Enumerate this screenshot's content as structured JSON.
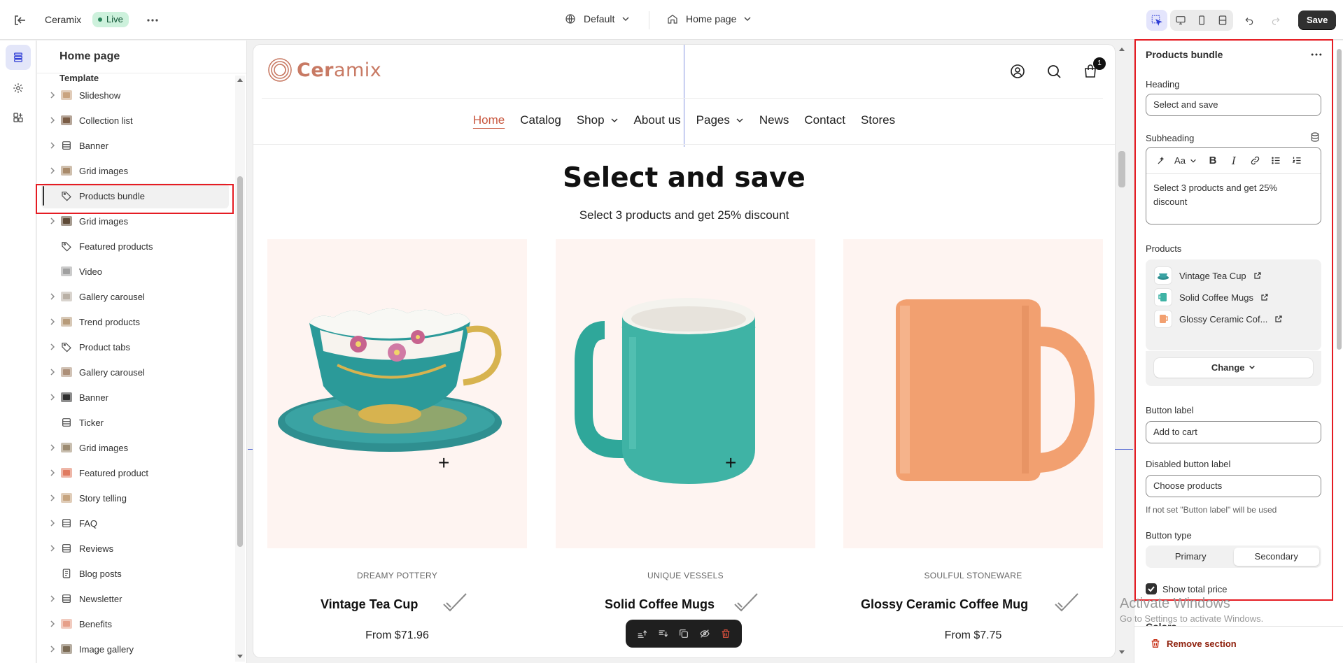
{
  "topbar": {
    "store_name": "Ceramix",
    "status_badge": "Live",
    "theme_selector": "Default",
    "page_selector": "Home page",
    "save_label": "Save"
  },
  "sidebar": {
    "title": "Home page",
    "group_label": "Template",
    "items": [
      {
        "label": "Slideshow",
        "icon": "image-thumbnail",
        "expandable": true
      },
      {
        "label": "Collection list",
        "icon": "image-thumbnail",
        "expandable": true
      },
      {
        "label": "Banner",
        "icon": "layout-icon",
        "expandable": true
      },
      {
        "label": "Grid images",
        "icon": "image-thumbnail",
        "expandable": true
      },
      {
        "label": "Products bundle",
        "icon": "tag-icon",
        "expandable": false,
        "selected": true
      },
      {
        "label": "Grid images",
        "icon": "image-thumbnail",
        "expandable": true
      },
      {
        "label": "Featured products",
        "icon": "tag-icon",
        "expandable": false
      },
      {
        "label": "Video",
        "icon": "image-thumbnail",
        "expandable": false
      },
      {
        "label": "Gallery carousel",
        "icon": "image-thumbnail",
        "expandable": true
      },
      {
        "label": "Trend products",
        "icon": "image-thumbnail",
        "expandable": true
      },
      {
        "label": "Product tabs",
        "icon": "tag-icon",
        "expandable": true
      },
      {
        "label": "Gallery carousel",
        "icon": "image-thumbnail",
        "expandable": true
      },
      {
        "label": "Banner",
        "icon": "image-thumbnail",
        "expandable": true
      },
      {
        "label": "Ticker",
        "icon": "layout-icon",
        "expandable": false
      },
      {
        "label": "Grid images",
        "icon": "image-thumbnail",
        "expandable": true
      },
      {
        "label": "Featured product",
        "icon": "image-thumbnail",
        "expandable": true
      },
      {
        "label": "Story telling",
        "icon": "image-thumbnail",
        "expandable": true
      },
      {
        "label": "FAQ",
        "icon": "layout-icon",
        "expandable": true
      },
      {
        "label": "Reviews",
        "icon": "layout-icon",
        "expandable": true
      },
      {
        "label": "Blog posts",
        "icon": "blog-icon",
        "expandable": false
      },
      {
        "label": "Newsletter",
        "icon": "layout-icon",
        "expandable": true
      },
      {
        "label": "Benefits",
        "icon": "image-thumbnail",
        "expandable": true
      },
      {
        "label": "Image gallery",
        "icon": "image-thumbnail",
        "expandable": true
      }
    ]
  },
  "preview": {
    "logo_text_bold": "Cer",
    "logo_text_light": "amix",
    "cart_count": "1",
    "nav": [
      "Home",
      "Catalog",
      "Shop",
      "About us",
      "Pages",
      "News",
      "Contact",
      "Stores"
    ],
    "heading": "Select and save",
    "subheading": "Select 3 products and get 25% discount",
    "products": [
      {
        "vendor": "DREAMY POTTERY",
        "name": "Vintage Tea Cup",
        "price": "From $71.96"
      },
      {
        "vendor": "UNIQUE VESSELS",
        "name": "Solid Coffee Mugs",
        "price": ""
      },
      {
        "vendor": "SOULFUL STONEWARE",
        "name": "Glossy Ceramic Coffee Mug",
        "price": "From $7.75"
      }
    ],
    "plus": "+"
  },
  "settings": {
    "title": "Products bundle",
    "heading_label": "Heading",
    "heading_value": "Select and save",
    "subheading_label": "Subheading",
    "subheading_value": "Select 3 products and get 25% discount",
    "products_label": "Products",
    "products": [
      "Vintage Tea Cup",
      "Solid Coffee Mugs",
      "Glossy Ceramic Cof..."
    ],
    "change_label": "Change",
    "button_label_label": "Button label",
    "button_label_value": "Add to cart",
    "disabled_label": "Disabled button label",
    "disabled_value": "Choose products",
    "disabled_help": "If not set \"Button label\" will be used",
    "button_type_label": "Button type",
    "button_types": [
      "Primary",
      "Secondary"
    ],
    "button_type_selected": "Secondary",
    "show_total_price_label": "Show total price",
    "show_total_price": true,
    "colors_label": "Colors",
    "remove_label": "Remove section"
  },
  "watermark": {
    "line1": "Activate Windows",
    "line2": "Go to Settings to activate Windows."
  },
  "colors": {
    "highlight": "#e51c23",
    "accent": "#2c3bd5",
    "logo": "#c87a64",
    "nav_active": "#c8563d",
    "card_bg": "#fef4f1",
    "teal": "#3fb3a5",
    "orange": "#f2a070"
  }
}
